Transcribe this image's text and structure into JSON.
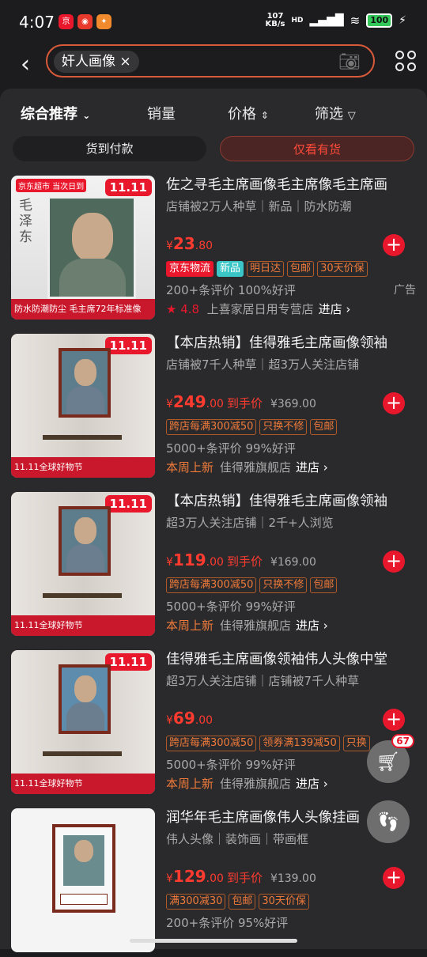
{
  "status": {
    "time": "4:07",
    "net_speed": "107",
    "net_unit": "KB/s",
    "hd": "HD",
    "battery": "100"
  },
  "search": {
    "query": "奸人画像",
    "clear": "×"
  },
  "sort": {
    "comprehensive": "综合推荐",
    "sales": "销量",
    "price": "价格",
    "filter": "筛选"
  },
  "filters": {
    "cod": "货到付款",
    "in_stock": "仅看有货"
  },
  "colors": {
    "accent": "#e8172c",
    "tag": "#f07a3a",
    "bg": "#2a2a2c"
  },
  "products": [
    {
      "title": "佐之寻毛主席画像毛主席像毛主席画",
      "sub": "店铺被2万人种草｜新品｜防水防潮",
      "price_int": "23",
      "price_dec": ".80",
      "price_label": "",
      "orig": "",
      "tags": [
        "京东物流",
        "新品",
        "明日达",
        "包邮",
        "30天价保"
      ],
      "reviews": "200+条评价  100%好评",
      "ad": "广告",
      "rating": "4.8",
      "store_prefix": "",
      "store": "上喜家居日用专营店",
      "go": "进店 ›",
      "thumb_tag": "11.11",
      "thumb_promo": "防水防潮防尘    毛主席72年标准像"
    },
    {
      "title": "【本店热销】佳得雅毛主席画像领袖",
      "sub": "店铺被7千人种草｜超3万人关注店铺",
      "price_int": "249",
      "price_dec": ".00",
      "price_label": "到手价",
      "orig": "¥369.00",
      "tags": [
        "跨店每满300减50",
        "只换不修",
        "包邮"
      ],
      "reviews": "5000+条评价  99%好评",
      "ad": "",
      "rating": "",
      "store_prefix": "本周上新",
      "store": "佳得雅旗舰店",
      "go": "进店 ›",
      "thumb_tag": "11.11",
      "thumb_promo": "11.11全球好物节"
    },
    {
      "title": "【本店热销】佳得雅毛主席画像领袖",
      "sub": "超3万人关注店铺｜2千+人浏览",
      "price_int": "119",
      "price_dec": ".00",
      "price_label": "到手价",
      "orig": "¥169.00",
      "tags": [
        "跨店每满300减50",
        "只换不修",
        "包邮"
      ],
      "reviews": "5000+条评价  99%好评",
      "ad": "",
      "rating": "",
      "store_prefix": "本周上新",
      "store": "佳得雅旗舰店",
      "go": "进店 ›",
      "thumb_tag": "11.11",
      "thumb_promo": "11.11全球好物节"
    },
    {
      "title": "佳得雅毛主席画像领袖伟人头像中堂",
      "sub": "超3万人关注店铺｜店铺被7千人种草",
      "price_int": "69",
      "price_dec": ".00",
      "price_label": "",
      "orig": "",
      "tags": [
        "跨店每满300减50",
        "领券满139减50",
        "只换"
      ],
      "reviews": "5000+条评价  99%好评",
      "ad": "",
      "rating": "",
      "store_prefix": "本周上新",
      "store": "佳得雅旗舰店",
      "go": "进店 ›",
      "thumb_tag": "11.11",
      "thumb_promo": "11.11全球好物节"
    },
    {
      "title": "润华年毛主席画像伟人头像挂画",
      "sub": "伟人头像｜装饰画｜带画框",
      "price_int": "129",
      "price_dec": ".00",
      "price_label": "到手价",
      "orig": "¥139.00",
      "tags": [
        "满300减30",
        "包邮",
        "30天价保"
      ],
      "reviews": "200+条评价  95%好评",
      "ad": "",
      "rating": "",
      "store_prefix": "",
      "store": "",
      "go": "",
      "thumb_tag": "",
      "thumb_promo": ""
    }
  ],
  "cart": {
    "count": "67"
  }
}
